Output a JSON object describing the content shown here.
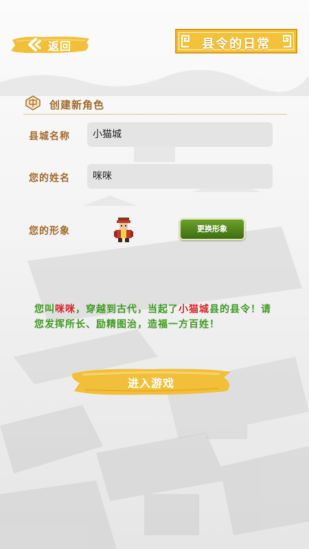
{
  "header": {
    "back_label": "返回",
    "game_title": "县令的日常"
  },
  "section": {
    "title": "创建新角色"
  },
  "form": {
    "county_label": "县城名称",
    "county_value": "小猫城",
    "name_label": "您的姓名",
    "name_value": "咪咪",
    "avatar_label": "您的形象",
    "change_avatar_button": "更换形象"
  },
  "story": {
    "part1": "您叫",
    "player_name": "咪咪",
    "part2": "，穿越到古代，当起了",
    "county_name": "小猫城",
    "part3": "县的县令！请您发挥所长、励精图治，造福一方百姓！"
  },
  "start_button": "进入游戏",
  "colors": {
    "accent_gold": "#f2c23a",
    "label_brown": "#a26a2c",
    "story_green": "#3f9a24",
    "highlight_red": "#d52626",
    "button_green": "#4f8a1c"
  }
}
